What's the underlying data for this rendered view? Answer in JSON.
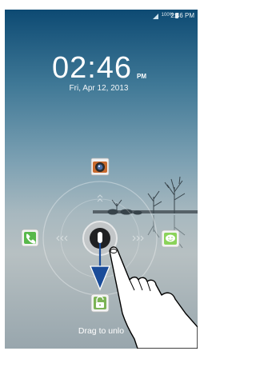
{
  "status_bar": {
    "battery_percent": "100%",
    "time": "2:46 PM",
    "icons": [
      "signal-icon",
      "battery-icon"
    ]
  },
  "lock_screen": {
    "time": "02:46",
    "ampm": "PM",
    "date": "Fri, Apr 12, 2013",
    "hint": "Drag to unlo"
  },
  "shortcuts": [
    {
      "name": "camera-shortcut",
      "icon": "camera-icon"
    },
    {
      "name": "phone-shortcut",
      "icon": "phone-icon"
    },
    {
      "name": "messaging-shortcut",
      "icon": "messaging-icon"
    },
    {
      "name": "unlock-shortcut",
      "icon": "unlock-icon"
    }
  ],
  "colors": {
    "accent": "#1a4c99",
    "phone_green": "#58b84b",
    "message_green": "#8bd35a"
  }
}
